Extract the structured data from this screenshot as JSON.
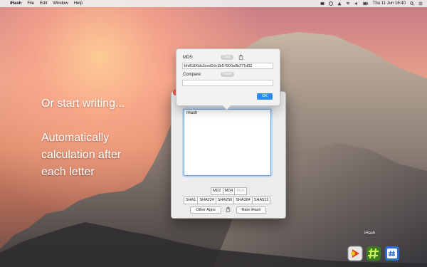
{
  "menubar": {
    "app_name": "iHash",
    "items": [
      "File",
      "Edit",
      "Window",
      "Help"
    ],
    "clock": "Thu 11 Jun 16:40"
  },
  "promo": {
    "line1": "Or start writing...",
    "line2a": "Automatically",
    "line2b": "calculation after",
    "line2c": "each letter"
  },
  "popover": {
    "md5_label": "MD5:",
    "copy_label": "Copy",
    "md5_value": "bfd6306dc2ced2dc3b57900a9b271d22",
    "compare_label": "Compare:",
    "paste_label": "Paste",
    "compare_value": "",
    "ok_label": "OK"
  },
  "window": {
    "input_text": "iHash",
    "algorithms_row1": [
      "MD2",
      "MD4",
      "MD5"
    ],
    "algorithms_row2": [
      "SHA1",
      "SHA224",
      "SHA256",
      "SHA384",
      "SHA512"
    ],
    "other_apps_label": "Other Apps",
    "rate_label": "Rate iHash"
  },
  "dock": {
    "label": "iHash",
    "icons": [
      "infuse-icon",
      "hashtag-app-icon",
      "ihash-app-icon"
    ]
  },
  "colors": {
    "accent": "#2d8df5",
    "focus_ring": "#6ca9e6",
    "close_button": "#ff5f57"
  }
}
